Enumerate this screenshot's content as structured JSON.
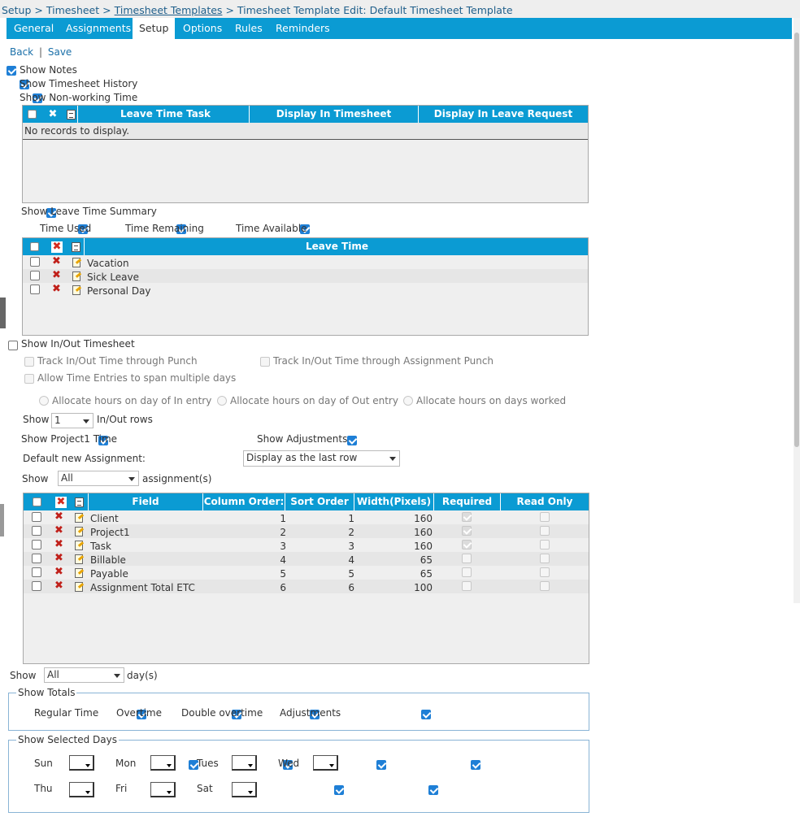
{
  "breadcrumb": {
    "setup": "Setup",
    "sep1": ">",
    "timesheet": "Timesheet",
    "sep2": ">",
    "templates": "Timesheet Templates",
    "sep3": ">",
    "current": "Timesheet Template Edit: Default Timesheet Template"
  },
  "tabs": [
    "General",
    "Assignments",
    "Setup",
    "Options",
    "Rules",
    "Reminders"
  ],
  "active_tab": "Setup",
  "actions": {
    "back": "Back",
    "sep": "|",
    "save": "Save"
  },
  "options": {
    "show_notes": "Show Notes",
    "show_history": "Show Timesheet History",
    "show_nonworking": "Show Non-working Time"
  },
  "nonworking_grid": {
    "columns": [
      "Leave Time Task",
      "Display In Timesheet",
      "Display In Leave Request"
    ],
    "empty": "No records to display."
  },
  "leave_summary": {
    "label": "Show Leave Time Summary",
    "time_used": "Time Used",
    "time_remaining": "Time Remaining",
    "time_available": "Time Available",
    "column": "Leave Time",
    "rows": [
      "Vacation",
      "Sick Leave",
      "Personal Day"
    ]
  },
  "inout": {
    "label": "Show In/Out Timesheet",
    "track_punch": "Track In/Out Time through Punch",
    "track_assignment": "Track In/Out Time through Assignment Punch",
    "allow_span": "Allow Time Entries to span multiple days",
    "alloc_in": "Allocate hours on day of In entry",
    "alloc_out": "Allocate hours on day of Out entry",
    "alloc_worked": "Allocate hours on days worked",
    "show": "Show",
    "rows_value": "1",
    "rows_suffix": "In/Out rows"
  },
  "project": {
    "label": "Show Project1 Time",
    "adjustments": "Show Adjustments",
    "default_label": "Default new Assignment:",
    "default_value": "Display as the last row",
    "show": "Show",
    "assign_value": "All",
    "assign_suffix": "assignment(s)"
  },
  "fields_grid": {
    "columns": [
      "Field",
      "Column Order:",
      "Sort Order",
      "Width(Pixels)",
      "Required",
      "Read Only"
    ],
    "rows": [
      {
        "field": "Client",
        "col": "1",
        "sort": "1",
        "width": "160",
        "required": true,
        "readonly": false
      },
      {
        "field": "Project1",
        "col": "2",
        "sort": "2",
        "width": "160",
        "required": true,
        "readonly": false
      },
      {
        "field": "Task",
        "col": "3",
        "sort": "3",
        "width": "160",
        "required": true,
        "readonly": false
      },
      {
        "field": "Billable",
        "col": "4",
        "sort": "4",
        "width": "65",
        "required": false,
        "readonly": false
      },
      {
        "field": "Payable",
        "col": "5",
        "sort": "5",
        "width": "65",
        "required": false,
        "readonly": false
      },
      {
        "field": "Assignment Total ETC",
        "col": "6",
        "sort": "6",
        "width": "100",
        "required": false,
        "readonly": false
      }
    ]
  },
  "days": {
    "show": "Show",
    "value": "All",
    "suffix": "day(s)"
  },
  "totals": {
    "legend": "Show Totals",
    "items": [
      "Regular Time",
      "Overtime",
      "Double overtime",
      "Adjustments"
    ]
  },
  "selected_days": {
    "legend": "Show Selected Days",
    "row1": [
      "Sun",
      "Mon",
      "Tues",
      "Wed"
    ],
    "row2": [
      "Thu",
      "Fri",
      "Sat"
    ]
  },
  "colors": {
    "accent": "#0b9bd3",
    "checkbox": "#1e7fd6",
    "delete": "#c0201a"
  }
}
